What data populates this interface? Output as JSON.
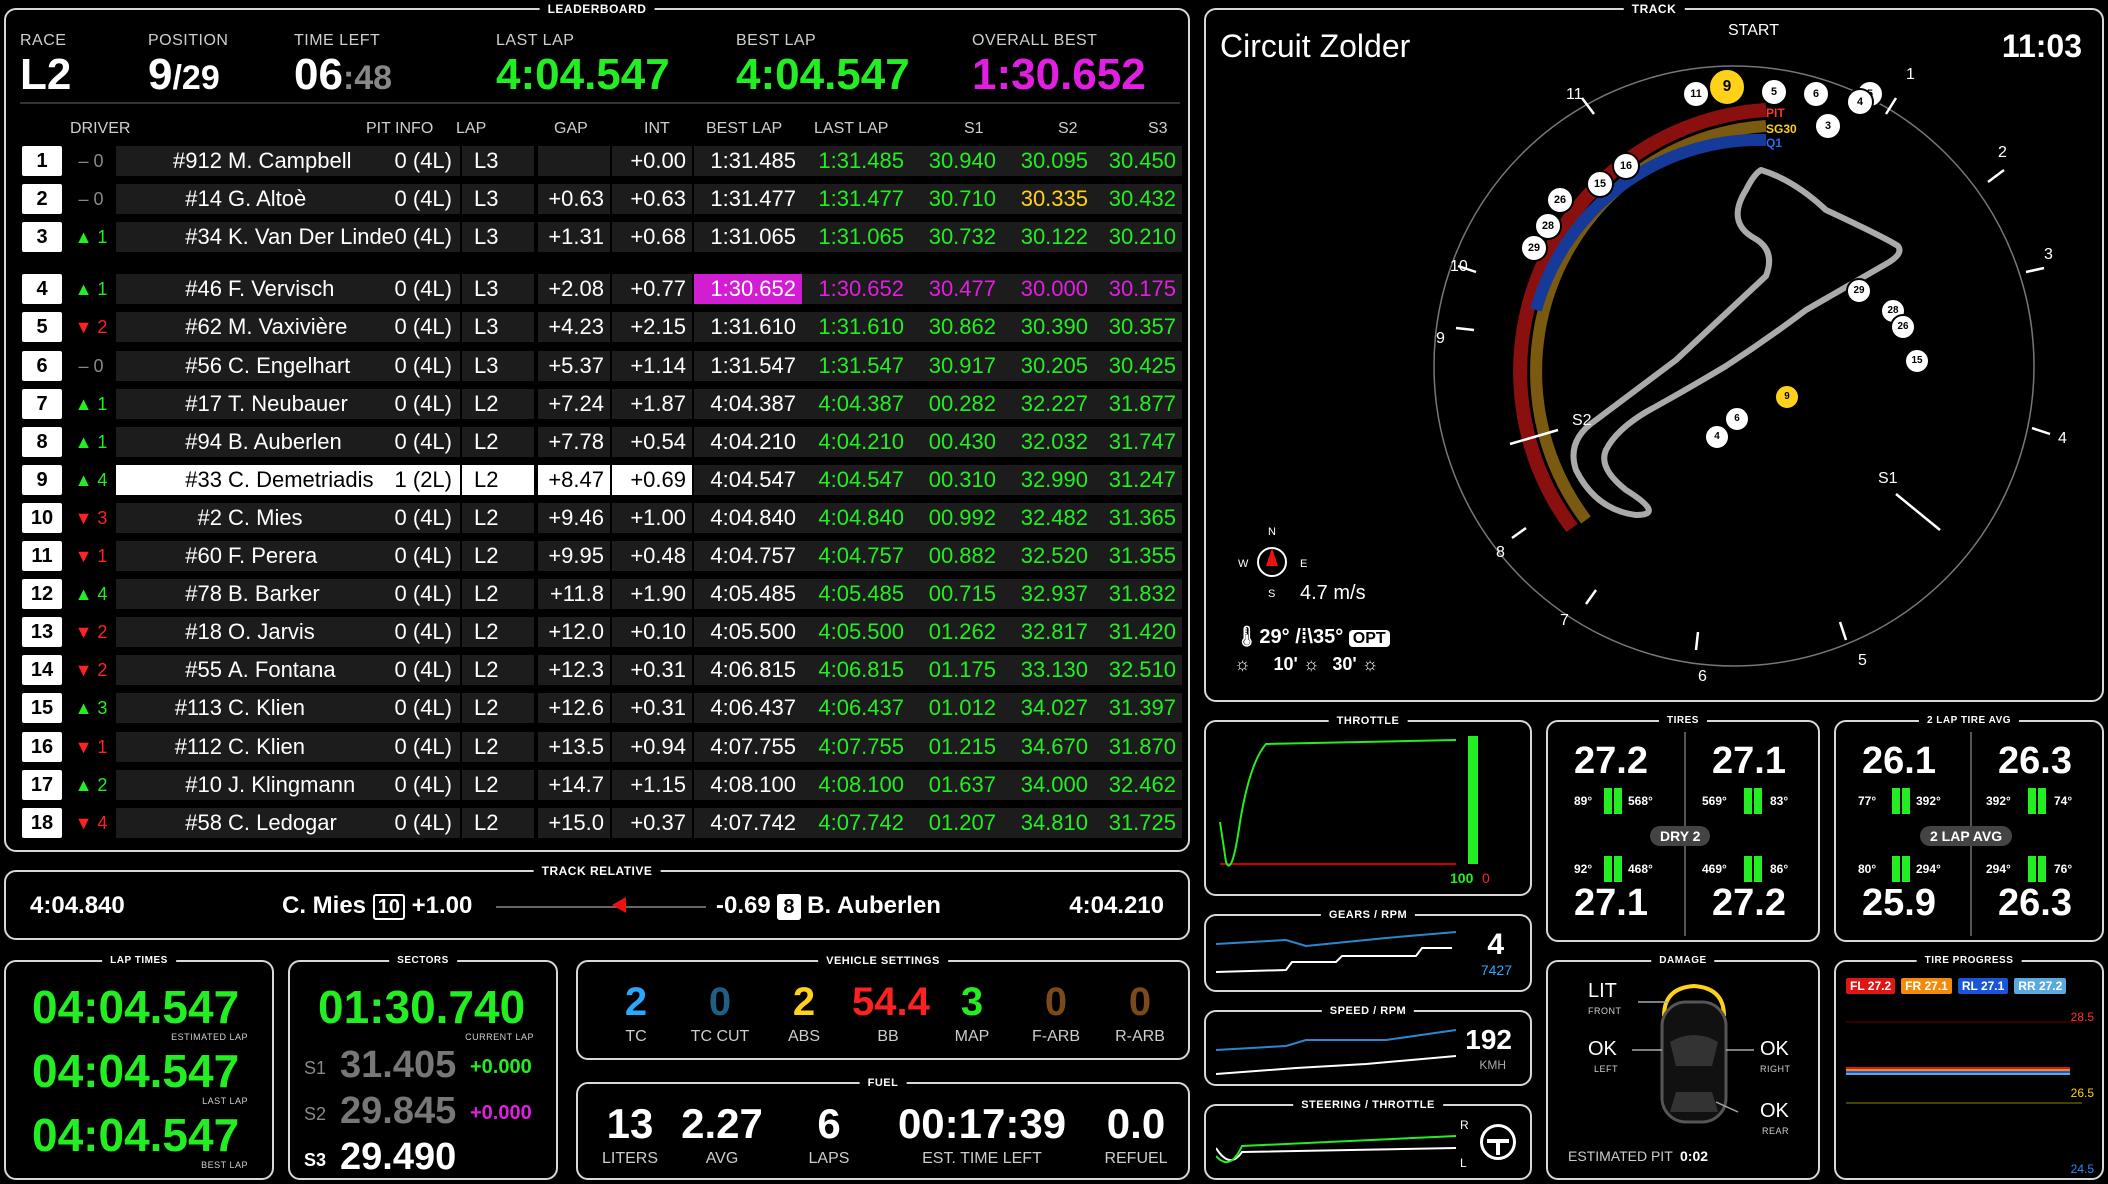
{
  "leaderboard": {
    "title": "LEADERBOARD",
    "race_label": "RACE",
    "race_value": "L2",
    "position_label": "POSITION",
    "position_value": "9",
    "position_total": "/29",
    "time_left_label": "TIME LEFT",
    "time_left_main": "06",
    "time_left_sec": ":48",
    "last_lap_label": "LAST LAP",
    "last_lap_value": "4:04.547",
    "best_lap_label": "BEST LAP",
    "best_lap_value": "4:04.547",
    "overall_best_label": "OVERALL BEST",
    "overall_best_value": "1:30.652",
    "columns": [
      "DRIVER",
      "PIT INFO",
      "LAP",
      "GAP",
      "INT",
      "BEST LAP",
      "LAST LAP",
      "S1",
      "S2",
      "S3"
    ],
    "rows": [
      {
        "pos": "1",
        "chg": "– 0",
        "dir": "none",
        "num": "#912",
        "name": "M. Campbell",
        "pit": "0 (4L)",
        "lap": "L3",
        "gap": "",
        "int": "+0.00",
        "best": "1:31.485",
        "last": "1:31.485",
        "s1": "30.940",
        "s2": "30.095",
        "s3": "30.450",
        "s2c": "g"
      },
      {
        "pos": "2",
        "chg": "– 0",
        "dir": "none",
        "num": "#14",
        "name": "G. Altoè",
        "pit": "0 (4L)",
        "lap": "L3",
        "gap": "+0.63",
        "int": "+0.63",
        "best": "1:31.477",
        "last": "1:31.477",
        "s1": "30.710",
        "s2": "30.335",
        "s3": "30.432",
        "s2c": "y"
      },
      {
        "pos": "3",
        "chg": "▲ 1",
        "dir": "up",
        "num": "#34",
        "name": "K. Van Der Linde",
        "pit": "0 (4L)",
        "lap": "L3",
        "gap": "+1.31",
        "int": "+0.68",
        "best": "1:31.065",
        "last": "1:31.065",
        "s1": "30.732",
        "s2": "30.122",
        "s3": "30.210",
        "s2c": "g"
      },
      {
        "pos": "4",
        "chg": "▲ 1",
        "dir": "up",
        "num": "#46",
        "name": "F. Vervisch",
        "pit": "0 (4L)",
        "lap": "L3",
        "gap": "+2.08",
        "int": "+0.77",
        "best": "1:30.652",
        "last": "1:30.652",
        "s1": "30.477",
        "s2": "30.000",
        "s3": "30.175",
        "s2c": "mg",
        "purple": true
      },
      {
        "pos": "5",
        "chg": "▼ 2",
        "dir": "down",
        "num": "#62",
        "name": "M. Vaxivière",
        "pit": "0 (4L)",
        "lap": "L3",
        "gap": "+4.23",
        "int": "+2.15",
        "best": "1:31.610",
        "last": "1:31.610",
        "s1": "30.862",
        "s2": "30.390",
        "s3": "30.357",
        "s2c": "g"
      },
      {
        "pos": "6",
        "chg": "– 0",
        "dir": "none",
        "num": "#56",
        "name": "C. Engelhart",
        "pit": "0 (4L)",
        "lap": "L3",
        "gap": "+5.37",
        "int": "+1.14",
        "best": "1:31.547",
        "last": "1:31.547",
        "s1": "30.917",
        "s2": "30.205",
        "s3": "30.425",
        "s2c": "g"
      },
      {
        "pos": "7",
        "chg": "▲ 1",
        "dir": "up",
        "num": "#17",
        "name": "T. Neubauer",
        "pit": "0 (4L)",
        "lap": "L2",
        "gap": "+7.24",
        "int": "+1.87",
        "best": "4:04.387",
        "last": "4:04.387",
        "s1": "00.282",
        "s2": "32.227",
        "s3": "31.877",
        "s2c": "g"
      },
      {
        "pos": "8",
        "chg": "▲ 1",
        "dir": "up",
        "num": "#94",
        "name": "B. Auberlen",
        "pit": "0 (4L)",
        "lap": "L2",
        "gap": "+7.78",
        "int": "+0.54",
        "best": "4:04.210",
        "last": "4:04.210",
        "s1": "00.430",
        "s2": "32.032",
        "s3": "31.747",
        "s2c": "g"
      },
      {
        "pos": "9",
        "chg": "▲ 4",
        "dir": "up",
        "num": "#33",
        "name": "C. Demetriadis",
        "pit": "1 (2L)",
        "lap": "L2",
        "gap": "+8.47",
        "int": "+0.69",
        "best": "4:04.547",
        "last": "4:04.547",
        "s1": "00.310",
        "s2": "32.990",
        "s3": "31.247",
        "s2c": "g",
        "player": true
      },
      {
        "pos": "10",
        "chg": "▼ 3",
        "dir": "down",
        "num": "#2",
        "name": "C. Mies",
        "pit": "0 (4L)",
        "lap": "L2",
        "gap": "+9.46",
        "int": "+1.00",
        "best": "4:04.840",
        "last": "4:04.840",
        "s1": "00.992",
        "s2": "32.482",
        "s3": "31.365",
        "s2c": "g"
      },
      {
        "pos": "11",
        "chg": "▼ 1",
        "dir": "down",
        "num": "#60",
        "name": "F. Perera",
        "pit": "0 (4L)",
        "lap": "L2",
        "gap": "+9.95",
        "int": "+0.48",
        "best": "4:04.757",
        "last": "4:04.757",
        "s1": "00.882",
        "s2": "32.520",
        "s3": "31.355",
        "s2c": "g"
      },
      {
        "pos": "12",
        "chg": "▲ 4",
        "dir": "up",
        "num": "#78",
        "name": "B. Barker",
        "pit": "0 (4L)",
        "lap": "L2",
        "gap": "+11.8",
        "int": "+1.90",
        "best": "4:05.485",
        "last": "4:05.485",
        "s1": "00.715",
        "s2": "32.937",
        "s3": "31.832",
        "s2c": "g"
      },
      {
        "pos": "13",
        "chg": "▼ 2",
        "dir": "down",
        "num": "#18",
        "name": "O. Jarvis",
        "pit": "0 (4L)",
        "lap": "L2",
        "gap": "+12.0",
        "int": "+0.10",
        "best": "4:05.500",
        "last": "4:05.500",
        "s1": "01.262",
        "s2": "32.817",
        "s3": "31.420",
        "s2c": "g"
      },
      {
        "pos": "14",
        "chg": "▼ 2",
        "dir": "down",
        "num": "#55",
        "name": "A. Fontana",
        "pit": "0 (4L)",
        "lap": "L2",
        "gap": "+12.3",
        "int": "+0.31",
        "best": "4:06.815",
        "last": "4:06.815",
        "s1": "01.175",
        "s2": "33.130",
        "s3": "32.510",
        "s2c": "g"
      },
      {
        "pos": "15",
        "chg": "▲ 3",
        "dir": "up",
        "num": "#113",
        "name": "C. Klien",
        "pit": "0 (4L)",
        "lap": "L2",
        "gap": "+12.6",
        "int": "+0.31",
        "best": "4:06.437",
        "last": "4:06.437",
        "s1": "01.012",
        "s2": "34.027",
        "s3": "31.397",
        "s2c": "g"
      },
      {
        "pos": "16",
        "chg": "▼ 1",
        "dir": "down",
        "num": "#112",
        "name": "C. Klien",
        "pit": "0 (4L)",
        "lap": "L2",
        "gap": "+13.5",
        "int": "+0.94",
        "best": "4:07.755",
        "last": "4:07.755",
        "s1": "01.215",
        "s2": "34.670",
        "s3": "31.870",
        "s2c": "g"
      },
      {
        "pos": "17",
        "chg": "▲ 2",
        "dir": "up",
        "num": "#10",
        "name": "J. Klingmann",
        "pit": "0 (4L)",
        "lap": "L2",
        "gap": "+14.7",
        "int": "+1.15",
        "best": "4:08.100",
        "last": "4:08.100",
        "s1": "01.637",
        "s2": "34.000",
        "s3": "32.462",
        "s2c": "g"
      },
      {
        "pos": "18",
        "chg": "▼ 4",
        "dir": "down",
        "num": "#58",
        "name": "C. Ledogar",
        "pit": "0 (4L)",
        "lap": "L2",
        "gap": "+15.0",
        "int": "+0.37",
        "best": "4:07.742",
        "last": "4:07.742",
        "s1": "01.207",
        "s2": "34.810",
        "s3": "31.725",
        "s2c": "g"
      }
    ]
  },
  "track": {
    "title": "TRACK",
    "name": "Circuit Zolder",
    "clock": "11:03",
    "start_label": "START",
    "pit_labels": [
      "PIT",
      "SG30",
      "Q1"
    ],
    "sector_labels": [
      "S1",
      "S2"
    ],
    "corner_numbers": [
      "1",
      "2",
      "3",
      "4",
      "5",
      "6",
      "7",
      "8",
      "9",
      "10",
      "11"
    ],
    "ring_cars": [
      "11",
      "9",
      "5",
      "6",
      "5",
      "4",
      "3",
      "16",
      "15",
      "26",
      "28",
      "29"
    ],
    "map_cars": [
      "29",
      "28",
      "26",
      "15",
      "9",
      "6",
      "4"
    ],
    "player_car": "9",
    "compass": {
      "n": "N",
      "s": "S",
      "e": "E",
      "w": "W"
    },
    "wind": "4.7 m/s",
    "air_temp": "29°",
    "track_temp": "35°",
    "opt_label": "OPT",
    "forecast_10": "10'",
    "forecast_30": "30'"
  },
  "relative": {
    "title": "TRACK RELATIVE",
    "left_time": "4:04.840",
    "left_name": "C. Mies",
    "left_pos": "10",
    "left_gap": "+1.00",
    "right_gap": "-0.69",
    "right_pos": "8",
    "right_name": "B. Auberlen",
    "right_time": "4:04.210"
  },
  "lap_times": {
    "title": "LAP TIMES",
    "estimated": "04:04.547",
    "estimated_label": "ESTIMATED LAP",
    "last": "04:04.547",
    "last_label": "LAST LAP",
    "best": "04:04.547",
    "best_label": "BEST LAP"
  },
  "sectors": {
    "title": "SECTORS",
    "current": "01:30.740",
    "current_label": "CURRENT LAP",
    "s1_label": "S1",
    "s1": "31.405",
    "s1_delta": "+0.000",
    "s2_label": "S2",
    "s2": "29.845",
    "s2_delta": "+0.000",
    "s3_label": "S3",
    "s3": "29.490"
  },
  "vehicle": {
    "title": "VEHICLE SETTINGS",
    "items": [
      {
        "value": "2",
        "label": "TC",
        "color": "#2aa8ff"
      },
      {
        "value": "0",
        "label": "TC CUT",
        "color": "#1f5f86"
      },
      {
        "value": "2",
        "label": "ABS",
        "color": "#ffd21a"
      },
      {
        "value": "54.4",
        "label": "BB",
        "color": "#ff2020"
      },
      {
        "value": "3",
        "label": "MAP",
        "color": "#22ee22"
      },
      {
        "value": "0",
        "label": "F-ARB",
        "color": "#7a4a1a"
      },
      {
        "value": "0",
        "label": "R-ARB",
        "color": "#7a4a1a"
      }
    ]
  },
  "fuel": {
    "title": "FUEL",
    "items": [
      {
        "value": "13",
        "label": "LITERS"
      },
      {
        "value": "2.27",
        "label": "AVG"
      },
      {
        "value": "6",
        "label": "LAPS"
      },
      {
        "value": "00:17:39",
        "label": "EST. TIME LEFT"
      },
      {
        "value": "0.0",
        "label": "REFUEL"
      }
    ]
  },
  "throttle": {
    "title": "THROTTLE",
    "throttle": "100",
    "brake": "0"
  },
  "gears": {
    "title": "GEARS / RPM",
    "gear": "4",
    "rpm": "7427"
  },
  "speed": {
    "title": "SPEED / RPM",
    "speed": "192",
    "unit": "KMH"
  },
  "steering": {
    "title": "STEERING / THROTTLE",
    "r": "R",
    "l": "L"
  },
  "tires": {
    "title": "TIRES",
    "fl": "27.2",
    "fr": "27.1",
    "rl": "27.1",
    "rr": "27.2",
    "fl_l": "89°",
    "fl_r": "568°",
    "fr_l": "569°",
    "fr_r": "83°",
    "rl_l": "92°",
    "rl_r": "468°",
    "rr_l": "469°",
    "rr_r": "86°",
    "compound": "DRY 2"
  },
  "tire_avg": {
    "title": "2 LAP TIRE AVG",
    "fl": "26.1",
    "fr": "26.3",
    "rl": "25.9",
    "rr": "26.3",
    "fl_l": "77°",
    "fl_r": "392°",
    "fr_l": "392°",
    "fr_r": "74°",
    "rl_l": "80°",
    "rl_r": "294°",
    "rr_l": "294°",
    "rr_r": "76°",
    "center": "2 LAP AVG"
  },
  "damage": {
    "title": "DAMAGE",
    "front_val": "LIT",
    "front": "FRONT",
    "left_val": "OK",
    "left": "LEFT",
    "right_val": "OK",
    "right": "RIGHT",
    "rear_val": "OK",
    "rear": "REAR",
    "pit_label": "ESTIMATED PIT",
    "pit_value": "0:02"
  },
  "tire_progress": {
    "title": "TIRE PROGRESS",
    "tags": [
      {
        "label": "FL 27.2",
        "color": "#e01515"
      },
      {
        "label": "FR 27.1",
        "color": "#f28a0a"
      },
      {
        "label": "RL 27.1",
        "color": "#1a55d8"
      },
      {
        "label": "RR 27.2",
        "color": "#5aa9e0"
      }
    ],
    "y_top": "28.5",
    "y_mid": "26.5",
    "y_bot": "24.5"
  }
}
